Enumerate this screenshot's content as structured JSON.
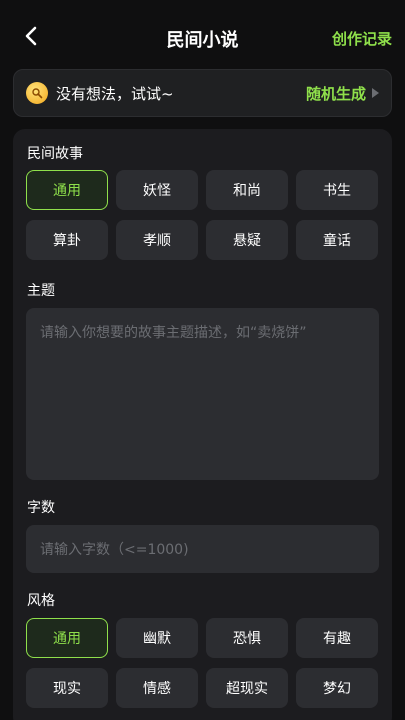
{
  "header": {
    "title": "民间小说",
    "record_label": "创作记录"
  },
  "idea": {
    "text": "没有想法，试试~",
    "random_label": "随机生成"
  },
  "sections": {
    "folk_label": "民间故事",
    "folk_options": [
      "通用",
      "妖怪",
      "和尚",
      "书生",
      "算卦",
      "孝顺",
      "悬疑",
      "童话"
    ],
    "folk_selected": "通用",
    "theme_label": "主题",
    "theme_placeholder": "请输入你想要的故事主题描述，如“卖烧饼”",
    "count_label": "字数",
    "count_placeholder": "请输入字数（<=1000)",
    "style_label": "风格",
    "style_options": [
      "通用",
      "幽默",
      "恐惧",
      "有趣",
      "现实",
      "情感",
      "超现实",
      "梦幻"
    ],
    "style_selected": "通用"
  },
  "colors": {
    "accent": "#8fe04b",
    "background": "#0f0f10",
    "panel": "#1c1c1f",
    "chip": "#2c2d31",
    "placeholder": "#6b6d72"
  }
}
